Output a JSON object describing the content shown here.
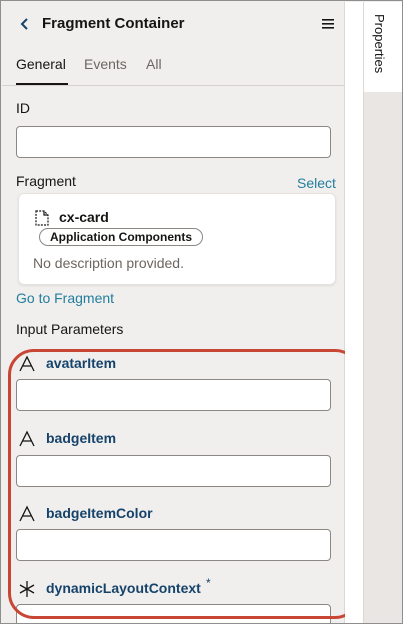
{
  "header": {
    "title": "Fragment Container",
    "back_icon": "chevron-left-icon",
    "menu_icon": "hamburger-menu-icon"
  },
  "tabs": [
    {
      "label": "General",
      "active": true
    },
    {
      "label": "Events",
      "active": false
    },
    {
      "label": "All",
      "active": false
    }
  ],
  "id_field": {
    "label": "ID",
    "value": ""
  },
  "fragment": {
    "label": "Fragment",
    "select_link": "Select",
    "card": {
      "name": "cx-card",
      "chip": "Application Components",
      "description": "No description provided.",
      "icon": "document-icon"
    },
    "go_link": "Go to Fragment"
  },
  "input_parameters": {
    "heading": "Input Parameters",
    "params": [
      {
        "name": "avatarItem",
        "type_icon": "string-type-icon",
        "value": "",
        "required": false
      },
      {
        "name": "badgeItem",
        "type_icon": "string-type-icon",
        "value": "",
        "required": false
      },
      {
        "name": "badgeItemColor",
        "type_icon": "string-type-icon",
        "value": "",
        "required": false
      },
      {
        "name": "dynamicLayoutContext",
        "type_icon": "any-type-icon",
        "value": "",
        "required": true,
        "required_mark": "*"
      }
    ]
  },
  "side_panel": {
    "tab_label": "Properties"
  },
  "colors": {
    "accent_link": "#227e9e",
    "param_label": "#16436b",
    "highlight": "#c74634",
    "panel_bg": "#f1efed"
  }
}
